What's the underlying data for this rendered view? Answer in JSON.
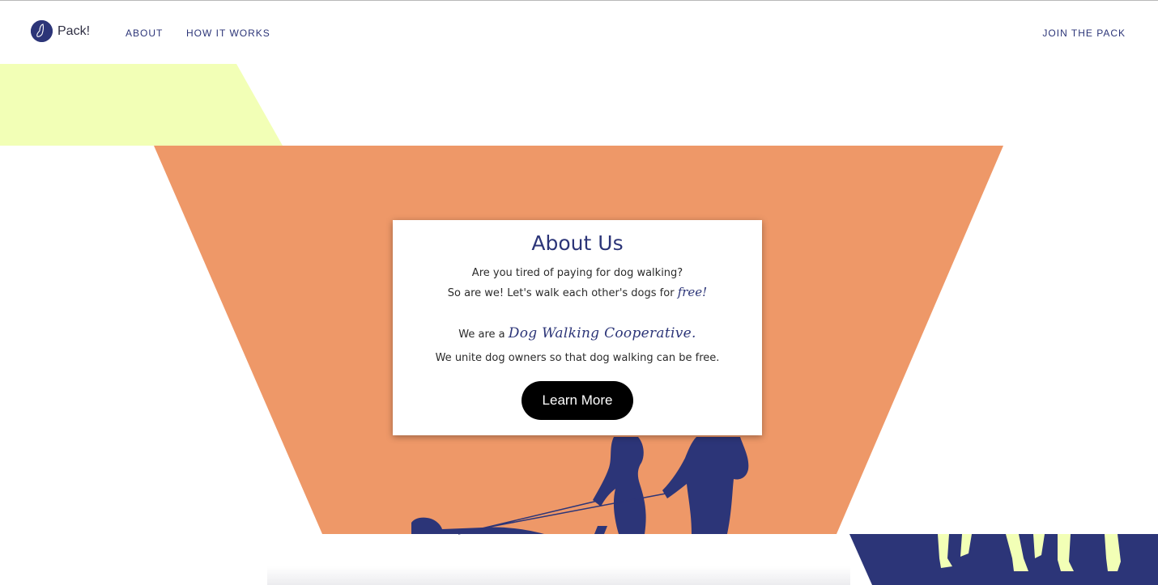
{
  "nav": {
    "brand": "Pack!",
    "about": "ABOUT",
    "how_it_works": "HOW IT WORKS",
    "join": "JOIN THE PACK"
  },
  "about": {
    "title": "About Us",
    "line1": "Are you tired of paying for dog walking?",
    "line2_prefix": "So are we! Let's walk each other's dogs for ",
    "line2_emphasis": "free!",
    "line3_prefix": "We are a ",
    "line3_emphasis": "Dog Walking Cooperative.",
    "line4": "We unite dog owners so that dog walking can be free.",
    "button": "Learn More"
  },
  "colors": {
    "navy": "#2c3578",
    "orange": "#ee9868",
    "pale_yellow": "#f2ffb6",
    "button": "#000000"
  },
  "icons": {
    "logo": "dog-head-logo-icon"
  }
}
